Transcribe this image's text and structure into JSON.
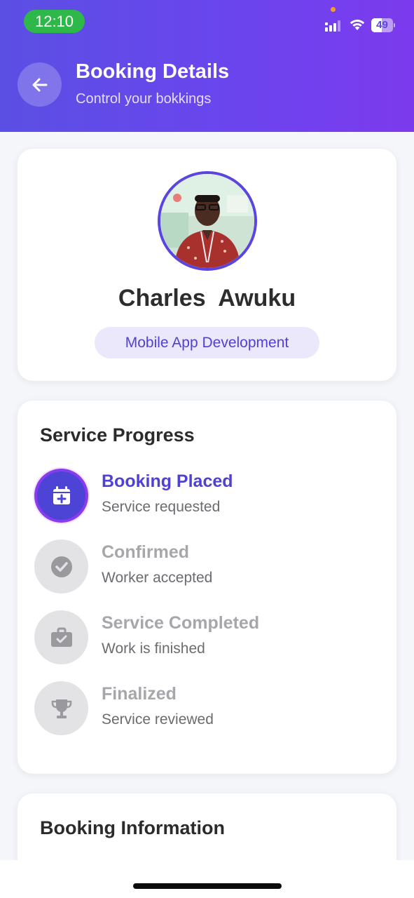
{
  "status_bar": {
    "time": "12:10",
    "battery": "49",
    "battery_level": 0.49,
    "icons": [
      "signal-icon",
      "wifi-icon",
      "battery-icon"
    ]
  },
  "header": {
    "title": "Booking Details",
    "subtitle": "Control your bokkings",
    "back_icon": "arrow-left-icon",
    "gradient": [
      "#5b4fe3",
      "#7c3aed"
    ]
  },
  "profile": {
    "name": "Charles  Awuku",
    "service": "Mobile App Development",
    "accent": "#5b45e0"
  },
  "progress": {
    "title": "Service Progress",
    "steps": [
      {
        "title": "Booking Placed",
        "description": "Service requested",
        "icon": "calendar-plus-icon",
        "active": true
      },
      {
        "title": "Confirmed",
        "description": "Worker accepted",
        "icon": "check-circle-icon",
        "active": false
      },
      {
        "title": "Service Completed",
        "description": "Work is finished",
        "icon": "briefcase-check-icon",
        "active": false
      },
      {
        "title": "Finalized",
        "description": "Service reviewed",
        "icon": "trophy-icon",
        "active": false
      }
    ]
  },
  "info": {
    "title": "Booking Information"
  }
}
